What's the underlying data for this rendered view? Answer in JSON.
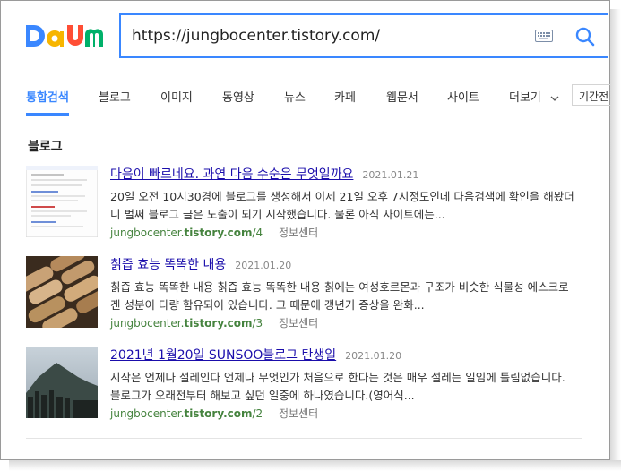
{
  "logo": {
    "text": "Daum",
    "colors": [
      "#3a87ff",
      "#f7b500",
      "#ff4e35",
      "#00b16a"
    ]
  },
  "search": {
    "value": "https://jungbocenter.tistory.com/"
  },
  "icons": {
    "keyboard": "keyboard-icon",
    "search": "search-icon",
    "chevron": "chevron-down-icon"
  },
  "tabs": [
    {
      "label": "통합검색",
      "active": true
    },
    {
      "label": "블로그"
    },
    {
      "label": "이미지"
    },
    {
      "label": "동영상"
    },
    {
      "label": "뉴스"
    },
    {
      "label": "카페"
    },
    {
      "label": "웹문서"
    },
    {
      "label": "사이트"
    }
  ],
  "more_label": "더보기",
  "period_label": "기간전",
  "section_title": "블로그",
  "results": [
    {
      "title": "다음이 빠르네요. 과연 다음 수순은 무엇일까요",
      "date": "2021.01.21",
      "desc": "20일 오전 10시30경에 블로그를 생성해서 이제 21일 오후 7시정도인데 다음검색에 확인을 해봤더니 벌써 블로그 글은 노출이 되기 시작했습니다. 물론 아직 사이트에는...",
      "url_host": "jungbocenter.",
      "url_bold": "tistory.com",
      "url_path": "/4",
      "category": "정보센터"
    },
    {
      "title": "칡즙 효능 똑똑한 내용",
      "date": "2021.01.20",
      "desc": "칡즙 효능 똑똑한 내용 칡즙 효능 똑똑한 내용 칡에는 여성호르몬과 구조가 비슷한 식물성 에스크로겐 성분이 다량 함유되어 있습니다. 그 때문에 갱년기 증상을 완화...",
      "url_host": "jungbocenter.",
      "url_bold": "tistory.com",
      "url_path": "/3",
      "category": "정보센터"
    },
    {
      "title": "2021년 1월20일 SUNSOO블로그 탄생일",
      "date": "2021.01.20",
      "desc": "시작은 언제나 설레인다 언제나 무엇인가 처음으로 한다는 것은 매우 설레는 일임에 틀림없습니다. 블로그가 오래전부터 해보고 싶던 일중에 하나였습니다.(영어식...",
      "url_host": "jungbocenter.",
      "url_bold": "tistory.com",
      "url_path": "/2",
      "category": "정보센터"
    }
  ]
}
